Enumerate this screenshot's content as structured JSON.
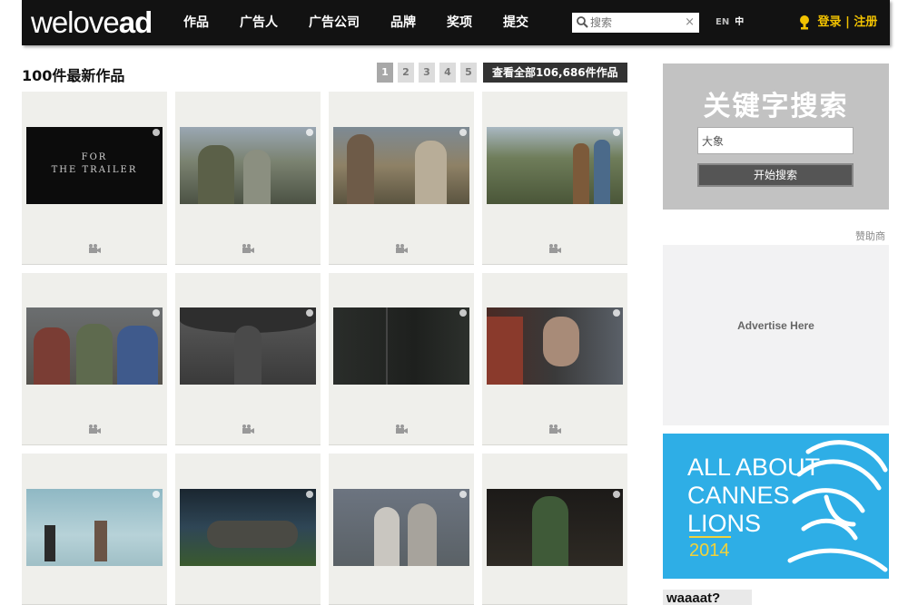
{
  "header": {
    "logo": {
      "part1": "welove",
      "part2": "ad"
    },
    "nav": [
      "作品",
      "广告人",
      "广告公司",
      "品牌",
      "奖项",
      "提交"
    ],
    "search_placeholder": "搜索",
    "search_clear": "×",
    "lang_en": "EN",
    "lang_zh": "中",
    "login": "登录",
    "separator": "|",
    "register": "注册"
  },
  "works": {
    "title": "100件最新作品",
    "pages": [
      "1",
      "2",
      "3",
      "4",
      "5"
    ],
    "view_all": "查看全部106,686件作品 ▶",
    "trailer_text": [
      "FOR",
      "THE TRAILER"
    ]
  },
  "sidebar": {
    "keyword_title": "关键字搜索",
    "keyword_value": "大象",
    "search_button": "开始搜索",
    "sponsor_label": "赞助商",
    "ad_text": "Advertise Here",
    "banner": {
      "lines": [
        "ALL ABOUT",
        "CANNES",
        "LIONS"
      ],
      "year": "2014"
    },
    "bottom_logo": "waaaat?"
  },
  "colors": {
    "topbar": "#121212",
    "accent_yellow": "#f2c200",
    "card_bg": "#efefeb",
    "cannes_blue": "#2eaee6"
  },
  "icons": {
    "search": "magnifier-icon",
    "trophy": "trophy-icon",
    "camera": "video-camera-icon",
    "cannes_lion": "lion-head-icon"
  }
}
